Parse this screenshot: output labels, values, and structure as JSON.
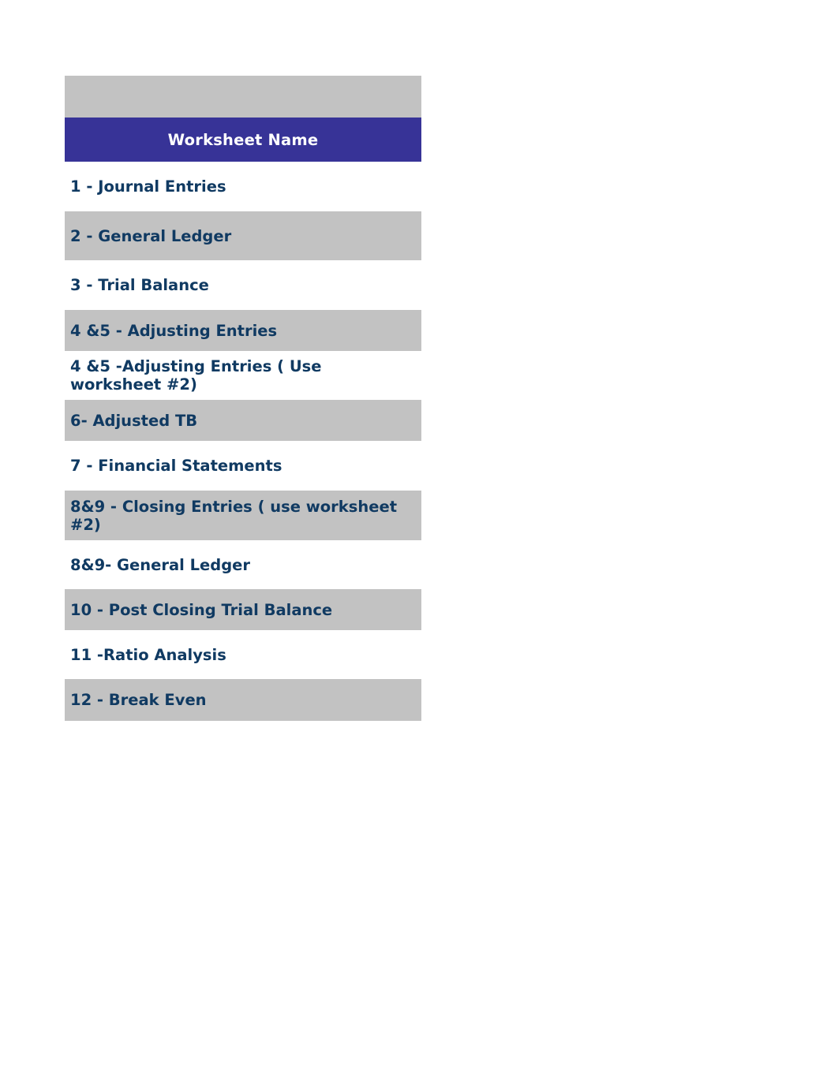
{
  "document": {
    "type": "spreadsheet-worksheet-index",
    "background_color": "#ffffff"
  },
  "colors": {
    "header_banner": "#373397",
    "header_text": "#ffffff",
    "row_shaded": "#c2c2c2",
    "row_plain": "#ffffff",
    "row_text": "#103a62"
  },
  "table": {
    "spacer_row_label": "",
    "header": {
      "label": "Worksheet Name"
    },
    "rows": [
      {
        "label": "1 - Journal Entries",
        "shaded": false
      },
      {
        "label": "2 - General Ledger",
        "shaded": true
      },
      {
        "label": "3 - Trial Balance",
        "shaded": false
      },
      {
        "label": "4 &5 - Adjusting Entries",
        "shaded": true
      },
      {
        "label": "4 &5 -Adjusting Entries ( Use worksheet #2)",
        "shaded": false
      },
      {
        "label": "6- Adjusted TB",
        "shaded": true
      },
      {
        "label": "7 - Financial Statements",
        "shaded": false
      },
      {
        "label": "8&9 - Closing Entries ( use worksheet #2)",
        "shaded": true
      },
      {
        "label": "8&9- General Ledger",
        "shaded": false
      },
      {
        "label": "10 - Post Closing Trial Balance",
        "shaded": true
      },
      {
        "label": "11 -Ratio Analysis",
        "shaded": false
      },
      {
        "label": "12 - Break Even",
        "shaded": true
      }
    ]
  }
}
